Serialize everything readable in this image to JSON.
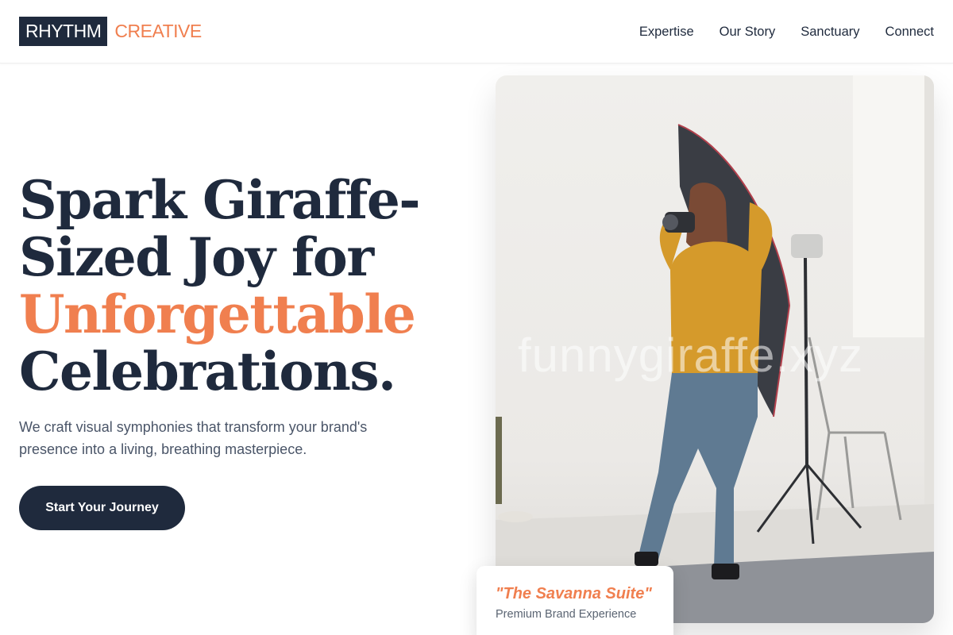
{
  "brand": {
    "logo_main": "RHYTHM",
    "logo_accent": "CREATIVE"
  },
  "nav": {
    "items": [
      {
        "label": "Expertise"
      },
      {
        "label": "Our Story"
      },
      {
        "label": "Sanctuary"
      },
      {
        "label": "Connect"
      }
    ]
  },
  "hero": {
    "headline_line1": "Spark Giraffe-",
    "headline_line2": "Sized Joy for",
    "headline_accent": "Unforgettable",
    "headline_line4": "Celebrations.",
    "subtitle": "We craft visual symphonies that transform your brand's presence into a living, breathing masterpiece.",
    "cta_label": "Start Your Journey"
  },
  "image": {
    "watermark": "funnygiraffe.xyz",
    "alt": "Photographer in a white studio with lighting equipment"
  },
  "caption": {
    "title": "\"The Savanna Suite\"",
    "subtitle": "Premium Brand Experience"
  },
  "colors": {
    "accent": "#f07f4f",
    "navy": "#1f2a3d",
    "muted": "#4a5568"
  }
}
